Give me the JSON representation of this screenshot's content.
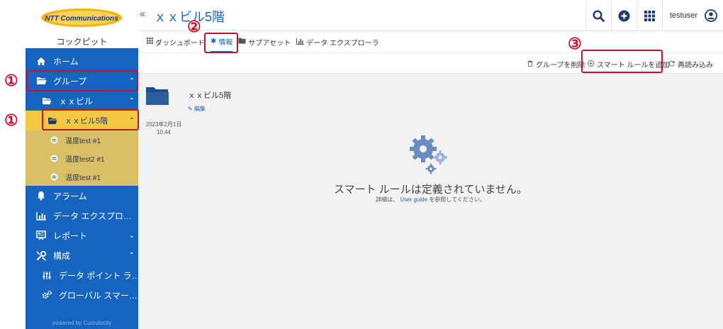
{
  "brand": {
    "logo_text": "NTT Communications",
    "label": "コックピット"
  },
  "sidebar": {
    "items": [
      {
        "label": "ホーム",
        "icon": "home-icon"
      },
      {
        "label": "グループ",
        "icon": "folder-open-icon",
        "chevron": "⌃"
      },
      {
        "label": "ｘｘビル",
        "icon": "folder-open-icon",
        "chevron": "⌃"
      },
      {
        "label": "ｘｘビル5階",
        "icon": "folder-open-icon",
        "chevron": "⌃"
      },
      {
        "label": "温度test #1",
        "icon": "device-icon"
      },
      {
        "label": "温度test2 #1",
        "icon": "device-icon"
      },
      {
        "label": "温度test #1",
        "icon": "device-icon"
      },
      {
        "label": "アラーム",
        "icon": "bell-icon"
      },
      {
        "label": "データ エクスプロ…",
        "icon": "bar-chart-icon"
      },
      {
        "label": "レポート",
        "icon": "report-icon",
        "chevron": "⌄"
      },
      {
        "label": "構成",
        "icon": "wrench-icon",
        "chevron": "⌃"
      },
      {
        "label": "データ ポイント ラ…",
        "icon": "sliders-icon"
      },
      {
        "label": "グローバル スマー…",
        "icon": "cogs-icon"
      }
    ],
    "powered": "powered by Cumulocity"
  },
  "header": {
    "collapse": "«",
    "title": "ｘｘビル5階",
    "username": "testuser",
    "icons": [
      "search-icon",
      "plus-circle-icon",
      "apps-grid-icon",
      "user-circle-icon"
    ]
  },
  "tabs": [
    {
      "label": "ダッシュボード",
      "icon": "grid-icon"
    },
    {
      "label": "情報",
      "icon": "asterisk-icon",
      "active": true
    },
    {
      "label": "サブアセット",
      "icon": "folder-icon"
    },
    {
      "label": "データ エクスプローラ",
      "icon": "bar-chart-icon"
    }
  ],
  "actions": {
    "delete_group": "グループを削除",
    "add_smart_rule": "スマート ルールを追加",
    "reload": "再読み込み"
  },
  "group_card": {
    "name": "ｘｘビル5階",
    "date": "2023年2月1日",
    "time": "10:44",
    "edit": "編集"
  },
  "empty_state": {
    "title": "スマート ルールは定義されていません。",
    "sub_prefix": "詳細は、",
    "sub_link": "User guide",
    "sub_suffix": "を参照してください。"
  },
  "annotations": {
    "one": "①",
    "two": "②",
    "three": "③"
  },
  "colors": {
    "primary": "#1565c0",
    "active_yellow": "#f5c842",
    "leaf_yellow": "#d9bf66",
    "annotation_red": "#c8102e"
  }
}
